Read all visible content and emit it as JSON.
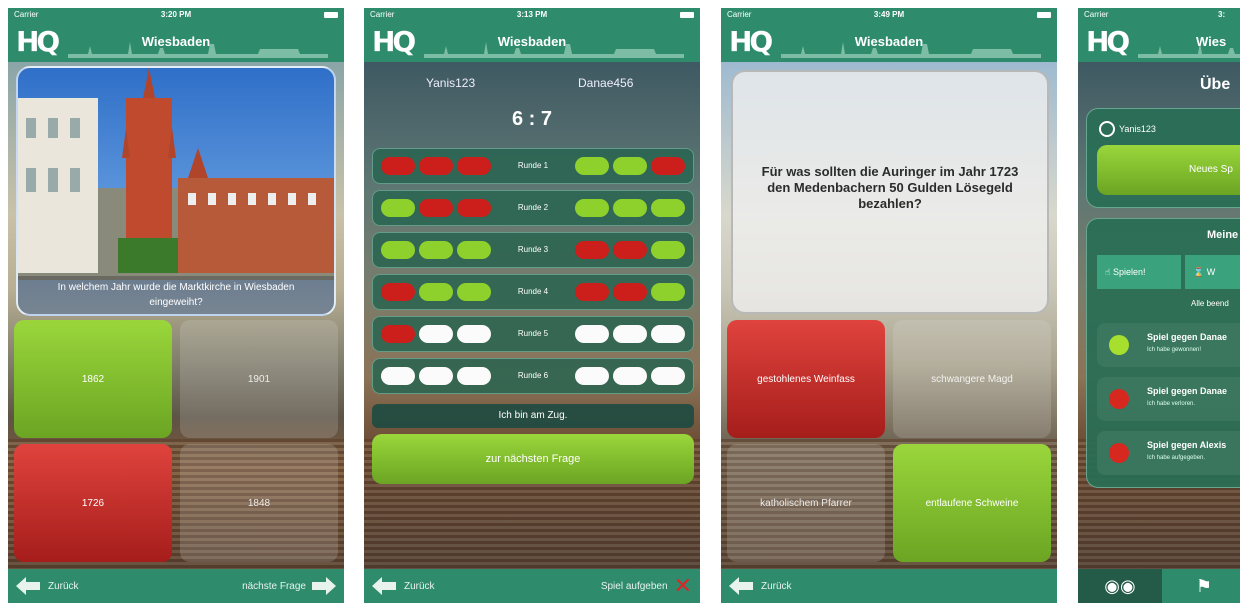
{
  "screens": [
    {
      "status": {
        "carrier": "Carrier",
        "time": "3:20 PM"
      },
      "header": {
        "logo": "HQ",
        "city": "Wiesbaden"
      },
      "question": "In welchem Jahr wurde die Marktkirche in Wiesbaden eingeweiht?",
      "answers": [
        "1862",
        "1901",
        "1726",
        "1848"
      ],
      "footer": {
        "back": "Zurück",
        "next": "nächste Frage"
      }
    },
    {
      "status": {
        "carrier": "Carrier",
        "time": "3:13 PM"
      },
      "header": {
        "logo": "HQ",
        "city": "Wiesbaden"
      },
      "player1": "Yanis123",
      "player2": "Danae456",
      "score": "6 : 7",
      "rounds": [
        {
          "label": "Runde 1",
          "left": [
            "r",
            "r",
            "r"
          ],
          "right": [
            "g",
            "g",
            "r"
          ]
        },
        {
          "label": "Runde 2",
          "left": [
            "g",
            "r",
            "r"
          ],
          "right": [
            "g",
            "g",
            "g"
          ]
        },
        {
          "label": "Runde 3",
          "left": [
            "g",
            "g",
            "g"
          ],
          "right": [
            "r",
            "r",
            "g"
          ]
        },
        {
          "label": "Runde 4",
          "left": [
            "r",
            "g",
            "g"
          ],
          "right": [
            "r",
            "r",
            "g"
          ]
        },
        {
          "label": "Runde 5",
          "left": [
            "r",
            "w",
            "w"
          ],
          "right": [
            "w",
            "w",
            "w"
          ]
        },
        {
          "label": "Runde 6",
          "left": [
            "w",
            "w",
            "w"
          ],
          "right": [
            "w",
            "w",
            "w"
          ]
        }
      ],
      "turn": "Ich bin am Zug.",
      "next_button": "zur nächsten Frage",
      "footer": {
        "back": "Zurück",
        "give_up": "Spiel aufgeben"
      }
    },
    {
      "status": {
        "carrier": "Carrier",
        "time": "3:49 PM"
      },
      "header": {
        "logo": "HQ",
        "city": "Wiesbaden"
      },
      "question": "Für was sollten die Auringer im Jahr 1723 den Medenbachern 50 Gulden Lösegeld bezahlen?",
      "answers": [
        "gestohlenes Weinfass",
        "schwangere Magd",
        "katholischem Pfarrer",
        "entlaufene Schweine"
      ],
      "footer": {
        "back": "Zurück"
      }
    },
    {
      "status": {
        "carrier": "Carrier",
        "time": "3:"
      },
      "header": {
        "logo": "HQ",
        "city": "Wies"
      },
      "title": "Übe",
      "user": "Yanis123",
      "new_game": "Neues Sp",
      "section": "Meine",
      "tabs": [
        "Spielen!",
        "W"
      ],
      "filter": "Alle beend",
      "games": [
        {
          "title": "Spiel gegen Danae",
          "sub": "Ich habe gewonnen!",
          "mood": "ok"
        },
        {
          "title": "Spiel gegen Danae",
          "sub": "Ich habe verloren.",
          "mood": "bad"
        },
        {
          "title": "Spiel gegen Alexis",
          "sub": "Ich habe aufgegeben.",
          "mood": "bad"
        }
      ],
      "colors": {
        "brand": "#2e8c6c",
        "correct": "#8fd12c",
        "wrong": "#cc1e1a",
        "empty": "#fbfbfb"
      }
    }
  ]
}
